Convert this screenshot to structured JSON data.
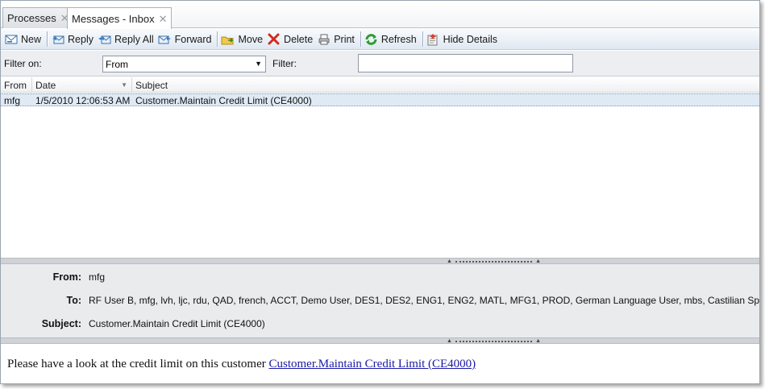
{
  "tabs": [
    {
      "label": "Processes",
      "close": "✕"
    },
    {
      "label": "Messages - Inbox",
      "close": "✕"
    }
  ],
  "toolbar": {
    "new": "New",
    "reply": "Reply",
    "reply_all": "Reply All",
    "forward": "Forward",
    "move": "Move",
    "delete": "Delete",
    "print": "Print",
    "refresh": "Refresh",
    "hide_details": "Hide Details"
  },
  "filter": {
    "filter_on_label": "Filter on:",
    "filter_on_value": "From",
    "filter_label": "Filter:",
    "filter_value": ""
  },
  "grid": {
    "columns": [
      "From",
      "Date",
      "Subject"
    ],
    "rows": [
      {
        "from": "mfg",
        "date": "1/5/2010 12:06:53 AM",
        "subject": "Customer.Maintain Credit Limit (CE4000)"
      }
    ]
  },
  "details": {
    "from_label": "From:",
    "from_value": "mfg",
    "to_label": "To:",
    "to_value": "RF User B, mfg, lvh, ljc, rdu, QAD, french, ACCT, Demo User, DES1, DES2, ENG1, ENG2, MATL, MFG1, PROD, German Language User, mbs, Castilian Spanish User, Du",
    "subject_label": "Subject:",
    "subject_value": "Customer.Maintain Credit Limit (CE4000)"
  },
  "body": {
    "text": "Please have a look at the credit limit on this customer ",
    "link": "Customer.Maintain Credit Limit (CE4000)"
  },
  "colors": {
    "selected_row": "#dfeaf5",
    "link": "#1a1aa6",
    "toolbar_gradient_end": "#dfe8f2"
  }
}
